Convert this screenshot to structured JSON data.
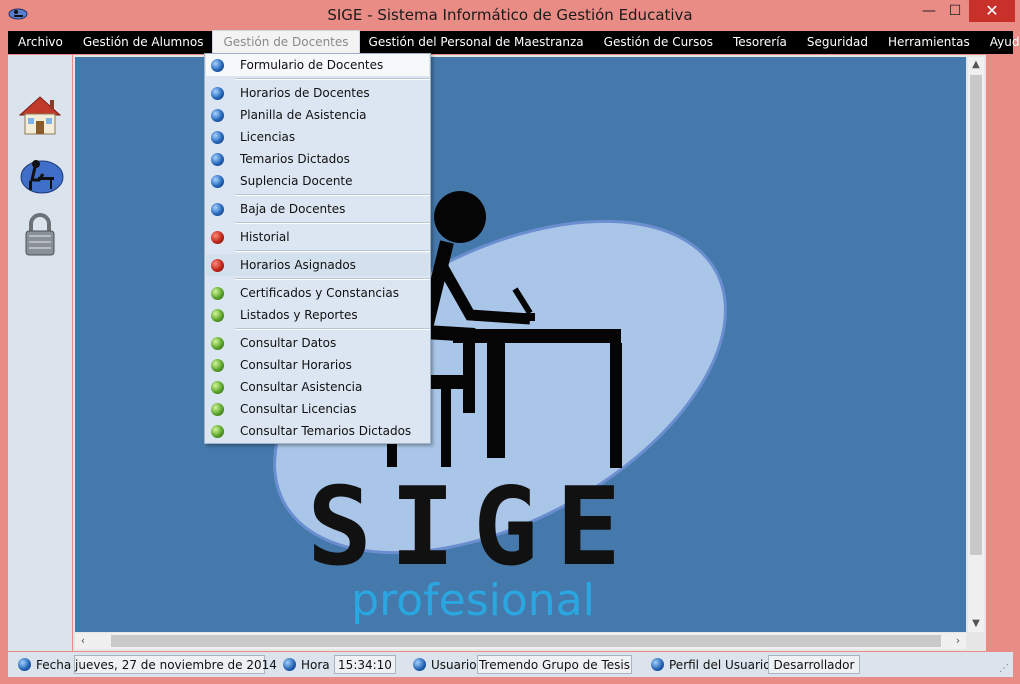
{
  "window": {
    "title": "SIGE - Sistema Informático de Gestión Educativa",
    "minimize_glyph": "—",
    "maximize_glyph": "☐",
    "close_glyph": "✕",
    "icon": "sige-app-icon"
  },
  "menubar": {
    "items": [
      {
        "label": "Archivo"
      },
      {
        "label": "Gestión de  Alumnos"
      },
      {
        "label": "Gestión de Docentes",
        "active": true
      },
      {
        "label": "Gestión del Personal de Maestranza"
      },
      {
        "label": "Gestión de Cursos"
      },
      {
        "label": "Tesorería"
      },
      {
        "label": "Seguridad"
      },
      {
        "label": "Herramientas"
      },
      {
        "label": "Ayuda"
      }
    ]
  },
  "toolbar": {
    "items": [
      {
        "icon": "home-icon"
      },
      {
        "icon": "teacher-desk-icon"
      },
      {
        "icon": "padlock-icon"
      }
    ]
  },
  "dropdown": {
    "items": [
      {
        "label": "Formulario de Docentes",
        "dot": "blue"
      },
      {
        "label": "Horarios de Docentes",
        "dot": "blue"
      },
      {
        "label": "Planilla de Asistencia",
        "dot": "blue"
      },
      {
        "label": "Licencias",
        "dot": "blue"
      },
      {
        "label": "Temarios Dictados",
        "dot": "blue"
      },
      {
        "label": "Suplencia Docente",
        "dot": "blue"
      },
      {
        "label": "Baja de Docentes",
        "dot": "blue"
      },
      {
        "label": "Historial",
        "dot": "red"
      },
      {
        "label": "Horarios Asignados",
        "dot": "red",
        "highlighted": true
      },
      {
        "label": "Certificados y Constancias",
        "dot": "green"
      },
      {
        "label": "Listados y Reportes",
        "dot": "green"
      },
      {
        "label": "Consultar Datos",
        "dot": "green"
      },
      {
        "label": "Consultar Horarios",
        "dot": "green"
      },
      {
        "label": "Consultar Asistencia",
        "dot": "green"
      },
      {
        "label": "Consultar Licencias",
        "dot": "green"
      },
      {
        "label": "Consultar Temarios Dictados",
        "dot": "green"
      }
    ]
  },
  "logo": {
    "title": "SIGE",
    "subtitle": "profesional"
  },
  "statusbar": {
    "fecha_label": "Fecha",
    "fecha_value": "jueves, 27 de noviembre de 2014",
    "hora_label": "Hora",
    "hora_value": "15:34:10",
    "usuario_label": "Usuario",
    "usuario_value": "Tremendo Grupo de Tesis",
    "perfil_label": "Perfil del Usuario",
    "perfil_value": "Desarrollador"
  },
  "colors": {
    "titlebar": "#ea8c86",
    "canvas": "#4579ab",
    "ellipse": "#a9c6e8",
    "logo_text": "#111111",
    "logo_subtitle": "#2aa7e0"
  }
}
